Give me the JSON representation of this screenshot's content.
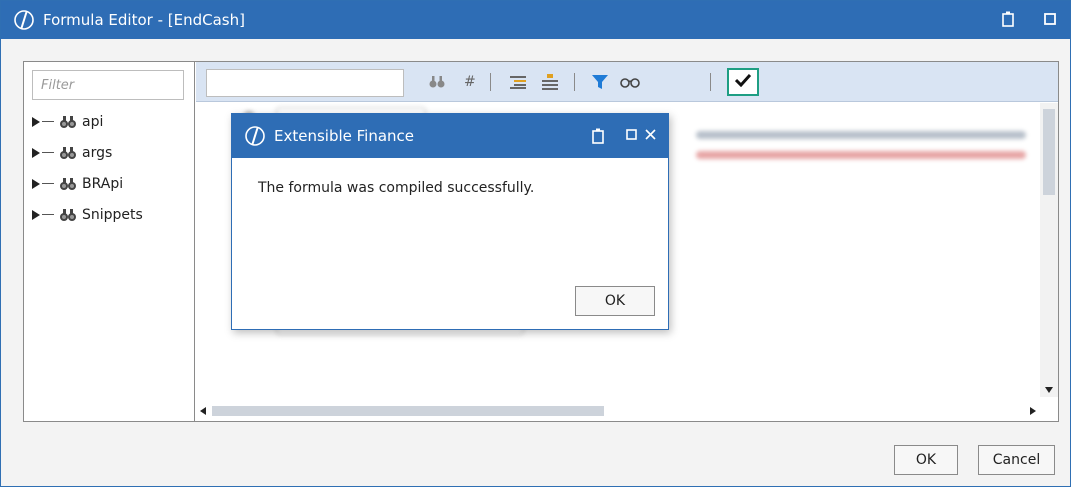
{
  "window": {
    "title": "Formula Editor - [EndCash]"
  },
  "left_panel": {
    "filter_placeholder": "Filter",
    "tree": [
      {
        "label": "api"
      },
      {
        "label": "args"
      },
      {
        "label": "BRApi"
      },
      {
        "label": "Snippets"
      }
    ]
  },
  "toolbar": {
    "icons": [
      "binoculars-icon",
      "hash-icon",
      "outdent-icon",
      "indent-icon",
      "filter-icon",
      "glasses-icon",
      "checkmark-icon"
    ],
    "compile_highlight_color": "#1e9e83"
  },
  "footer": {
    "ok_label": "OK",
    "cancel_label": "Cancel"
  },
  "dialog": {
    "title": "Extensible Finance",
    "message": "The formula was compiled successfully.",
    "ok_label": "OK"
  },
  "colors": {
    "titlebar": "#2e6db5",
    "toolbar_bg": "#d9e4f3"
  }
}
